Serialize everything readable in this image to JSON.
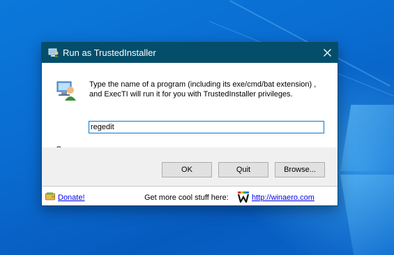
{
  "window": {
    "title": "Run as TrustedInstaller",
    "close_glyph": "✕",
    "close_icon": "close-icon",
    "title_icon": "app-icon"
  },
  "dialog": {
    "description": "Type the name of a program (including its exe/cmd/bat extension) , and ExecTI will run it for you with TrustedInstaller privileges.",
    "open_label": "Open:",
    "open_value": "regedit",
    "program_icon": "computer-user-icon"
  },
  "buttons": {
    "ok": "OK",
    "quit": "Quit",
    "browse": "Browse..."
  },
  "footer": {
    "donate_label": "Donate!",
    "donate_icon": "wallet-icon",
    "promo_text": "Get more cool stuff here:",
    "winaero_icon": "winaero-logo-icon",
    "winaero_link": "http://winaero.com"
  },
  "colors": {
    "titlebar": "#044e6b",
    "accent": "#0078d7",
    "desktop": "#0a6cd0"
  }
}
